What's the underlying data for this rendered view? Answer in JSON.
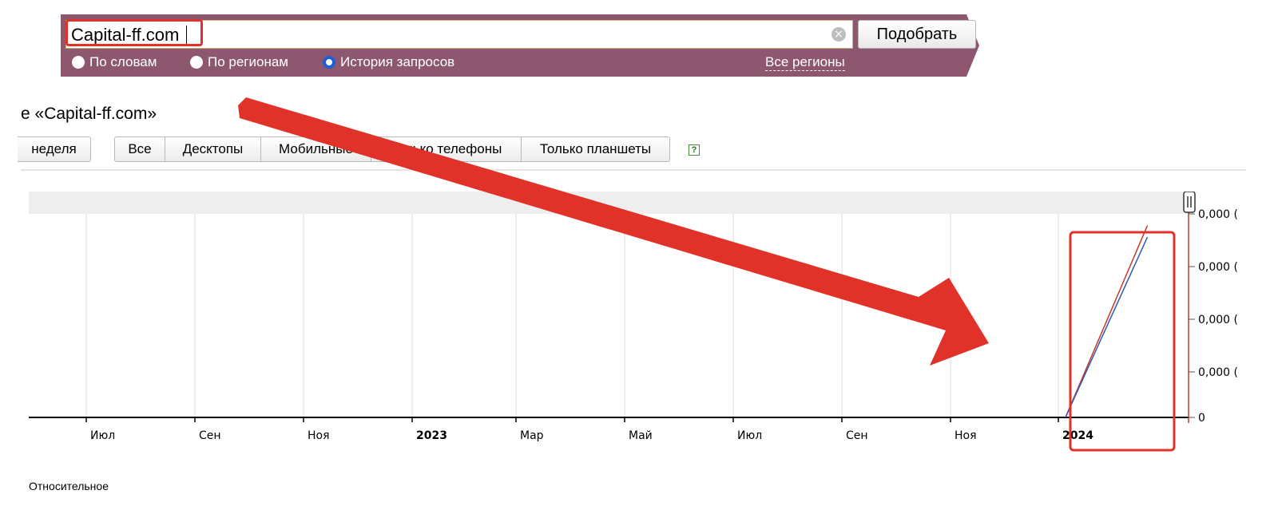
{
  "search": {
    "query": "Capital-ff.com",
    "submit_label": "Подобрать",
    "modes": [
      {
        "label": "По словам",
        "checked": false
      },
      {
        "label": "По регионам",
        "checked": false
      },
      {
        "label": "История запросов",
        "checked": true
      }
    ],
    "regions_link": "Все регионы",
    "clear_icon": "clear-icon"
  },
  "page": {
    "title": "е «Capital-ff.com»",
    "period_label": "неделя",
    "device_tabs": [
      {
        "label": "Все",
        "active": true
      },
      {
        "label": "Десктопы",
        "active": false
      },
      {
        "label": "Мобильные",
        "active": false
      },
      {
        "label": "Только телефоны",
        "active": false
      },
      {
        "label": "Только планшеты",
        "active": false
      }
    ],
    "help_label": "?",
    "relative_label": "Относительное"
  },
  "colors": {
    "panel": "#8e5770",
    "highlight": "#e03228",
    "series_red": "#c0392b",
    "series_blue": "#3355bb",
    "radio_checked": "#1a5fd6"
  },
  "chart_data": {
    "type": "line",
    "x_ticks": [
      {
        "label": "Июл",
        "bold": false
      },
      {
        "label": "Сен",
        "bold": false
      },
      {
        "label": "Ноя",
        "bold": false
      },
      {
        "label": "2023",
        "bold": true
      },
      {
        "label": "Мар",
        "bold": false
      },
      {
        "label": "Май",
        "bold": false
      },
      {
        "label": "Июл",
        "bold": false
      },
      {
        "label": "Сен",
        "bold": false
      },
      {
        "label": "Ноя",
        "bold": false
      },
      {
        "label": "2024",
        "bold": true
      }
    ],
    "y_tick_labels": [
      "0,000 (",
      "0,000 (",
      "0,000 (",
      "0,000 (",
      "0"
    ],
    "series": [
      {
        "color": "#c0392b",
        "points": [
          [
            "2024-01-05",
            0
          ],
          [
            "2024-02-20",
            3.3e-05
          ]
        ]
      },
      {
        "color": "#3355bb",
        "points": [
          [
            "2024-01-05",
            0
          ],
          [
            "2024-02-20",
            3.1e-05
          ]
        ]
      }
    ],
    "grid": "vertical",
    "scrollbar_icon": "pause-handle-icon"
  }
}
